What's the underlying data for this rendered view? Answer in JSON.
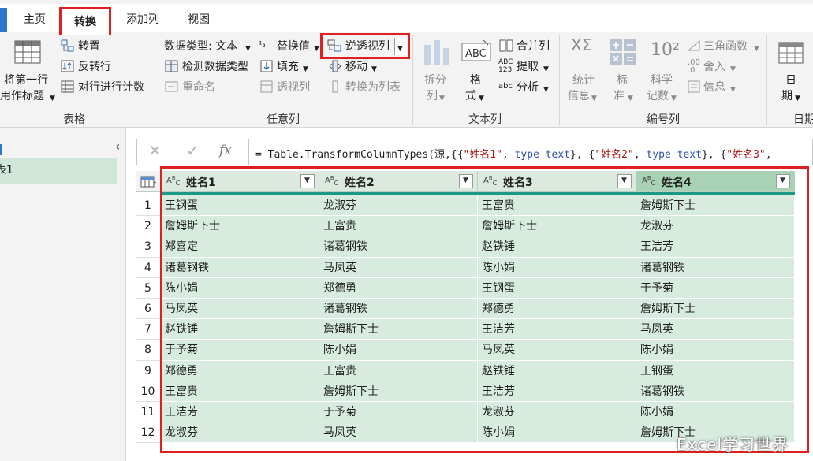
{
  "tabs": {
    "home": "主页",
    "transform": "转换",
    "add_column": "添加列",
    "view": "视图"
  },
  "ribbon": {
    "table_group": {
      "title": "表格",
      "use_first_row_line1": "将第一行",
      "use_first_row_line2": "用作标题",
      "transpose": "转置",
      "reverse_rows": "反转行",
      "count_rows": "对行进行计数"
    },
    "any_column_group": {
      "title": "任意列",
      "data_type": "数据类型: 文本",
      "detect_type": "检测数据类型",
      "rename": "重命名",
      "replace_values": "替换值",
      "fill": "填充",
      "pivot": "透视列",
      "unpivot": "逆透视列",
      "move": "移动",
      "to_list": "转换为列表"
    },
    "text_column_group": {
      "title": "文本列",
      "split_line1": "拆分",
      "split_line2": "列",
      "format_line1": "格",
      "format_line2": "式",
      "merge": "合并列",
      "extract": "提取",
      "parse": "分析"
    },
    "number_column_group": {
      "title": "编号列",
      "stats_line1": "统计",
      "stats_line2": "信息",
      "standard_line1": "标",
      "standard_line2": "准",
      "scientific_line1": "科学",
      "scientific_line2": "记数",
      "trig": "三角函数",
      "rounding": "舍入",
      "info": "信息"
    },
    "date_group": {
      "title": "日期",
      "date_line1": "日",
      "date_line2": "期"
    }
  },
  "query_pane": {
    "selected_query": "表1"
  },
  "formula_bar": {
    "fx": "fx",
    "prefix": "= Table.TransformColumnTypes(源,{{",
    "s1": "\"姓名1\"",
    "s2": "\"姓名2\"",
    "s3": "\"姓名3\"",
    "type_kw": "type",
    "text_kw": "text",
    "mid": "}, {"
  },
  "grid": {
    "type_icon": "ABC",
    "columns": [
      "姓名1",
      "姓名2",
      "姓名3",
      "姓名4"
    ],
    "rows": [
      {
        "idx": "1",
        "c": [
          "王钢蛋",
          "龙淑芬",
          "王富贵",
          "詹姆斯下士"
        ]
      },
      {
        "idx": "2",
        "c": [
          "詹姆斯下士",
          "王富贵",
          "詹姆斯下士",
          "龙淑芬"
        ]
      },
      {
        "idx": "3",
        "c": [
          "郑喜定",
          "诸葛钢铁",
          "赵铁锤",
          "王洁芳"
        ]
      },
      {
        "idx": "4",
        "c": [
          "诸葛钢铁",
          "马凤英",
          "陈小娟",
          "诸葛钢铁"
        ]
      },
      {
        "idx": "5",
        "c": [
          "陈小娟",
          "郑德勇",
          "王钢蛋",
          "于予菊"
        ]
      },
      {
        "idx": "6",
        "c": [
          "马凤英",
          "诸葛钢铁",
          "郑德勇",
          "詹姆斯下士"
        ]
      },
      {
        "idx": "7",
        "c": [
          "赵铁锤",
          "詹姆斯下士",
          "王洁芳",
          "马凤英"
        ]
      },
      {
        "idx": "8",
        "c": [
          "于予菊",
          "陈小娟",
          "马凤英",
          "陈小娟"
        ]
      },
      {
        "idx": "9",
        "c": [
          "郑德勇",
          "王富贵",
          "赵铁锤",
          "王钢蛋"
        ]
      },
      {
        "idx": "10",
        "c": [
          "王富贵",
          "詹姆斯下士",
          "王洁芳",
          "诸葛钢铁"
        ]
      },
      {
        "idx": "11",
        "c": [
          "王洁芳",
          "于予菊",
          "龙淑芬",
          "陈小娟"
        ]
      },
      {
        "idx": "12",
        "c": [
          "龙淑芬",
          "马凤英",
          "陈小娟",
          "詹姆斯下士"
        ]
      }
    ]
  },
  "watermark": "Excel学习世界",
  "colors": {
    "highlight_red": "#e02020",
    "cell_green": "#d7ecde",
    "header_green": "#dbe9df",
    "selected_header": "#a9d2b4",
    "quality_bar": "#1a9a86"
  }
}
